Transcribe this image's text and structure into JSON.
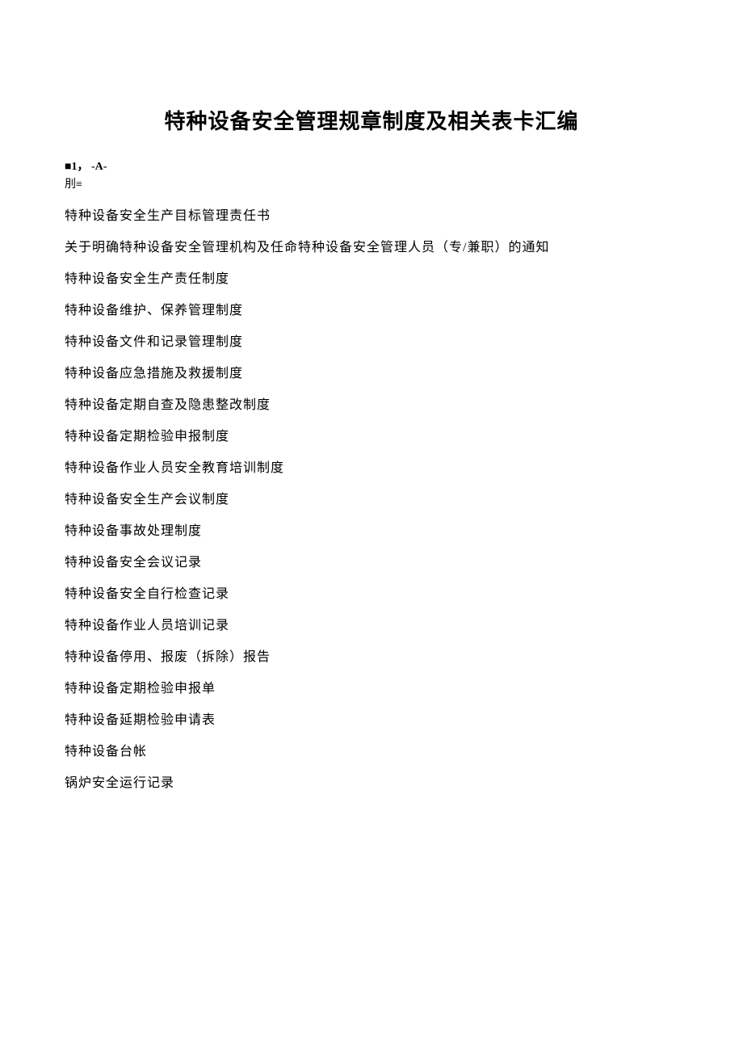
{
  "title": "特种设备安全管理规章制度及相关表卡汇编",
  "header": {
    "line1": "■1，   -A-",
    "line2": "刖≡"
  },
  "toc": {
    "items": [
      "特种设备安全生产目标管理责任书",
      "关于明确特种设备安全管理机构及任命特种设备安全管理人员（专/兼职）的通知",
      "特种设备安全生产责任制度",
      "特种设备维护、保养管理制度",
      "特种设备文件和记录管理制度",
      "特种设备应急措施及救援制度",
      "特种设备定期自查及隐患整改制度",
      "特种设备定期检验申报制度",
      "特种设备作业人员安全教育培训制度",
      "特种设备安全生产会议制度",
      "特种设备事故处理制度",
      "特种设备安全会议记录",
      "特种设备安全自行检查记录",
      "特种设备作业人员培训记录",
      "特种设备停用、报废（拆除）报告",
      "特种设备定期检验申报单",
      "特种设备延期检验申请表",
      "特种设备台帐",
      "锅炉安全运行记录"
    ]
  }
}
